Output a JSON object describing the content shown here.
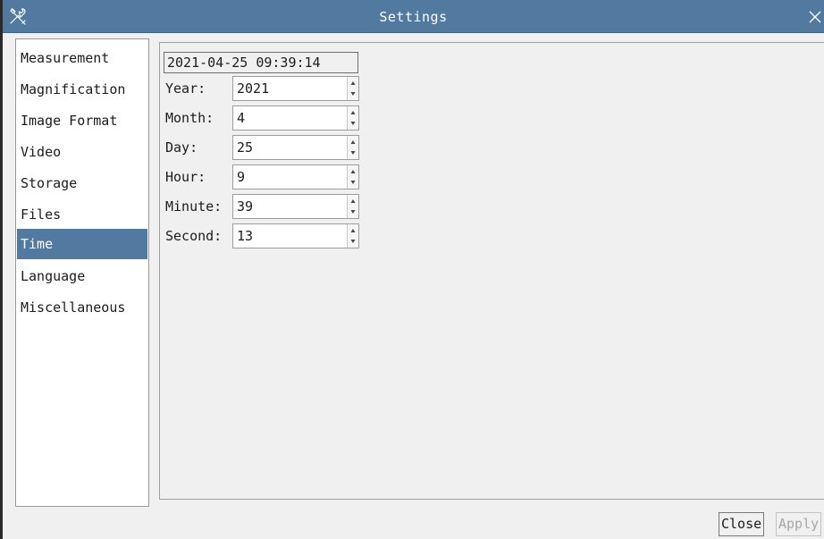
{
  "window": {
    "title": "Settings",
    "app_icon": "tools-icon",
    "close_icon": "close-icon"
  },
  "sidebar": {
    "selected_index": 6,
    "items": [
      {
        "label": "Measurement"
      },
      {
        "label": "Magnification"
      },
      {
        "label": "Image Format"
      },
      {
        "label": "Video"
      },
      {
        "label": "Storage"
      },
      {
        "label": "Files"
      },
      {
        "label": "Time"
      },
      {
        "label": "Language"
      },
      {
        "label": "Miscellaneous"
      }
    ]
  },
  "time": {
    "current": "2021-04-25 09:39:14",
    "fields": [
      {
        "label": "Year:",
        "value": "2021"
      },
      {
        "label": "Month:",
        "value": "4"
      },
      {
        "label": "Day:",
        "value": "25"
      },
      {
        "label": "Hour:",
        "value": "9"
      },
      {
        "label": "Minute:",
        "value": "39"
      },
      {
        "label": "Second:",
        "value": "13"
      }
    ]
  },
  "buttons": {
    "close_label": "Close",
    "apply_label": "Apply",
    "apply_enabled": false
  },
  "colors": {
    "titlebar": "#527aa1",
    "selection": "#527aa1",
    "background": "#f0f0f0"
  }
}
